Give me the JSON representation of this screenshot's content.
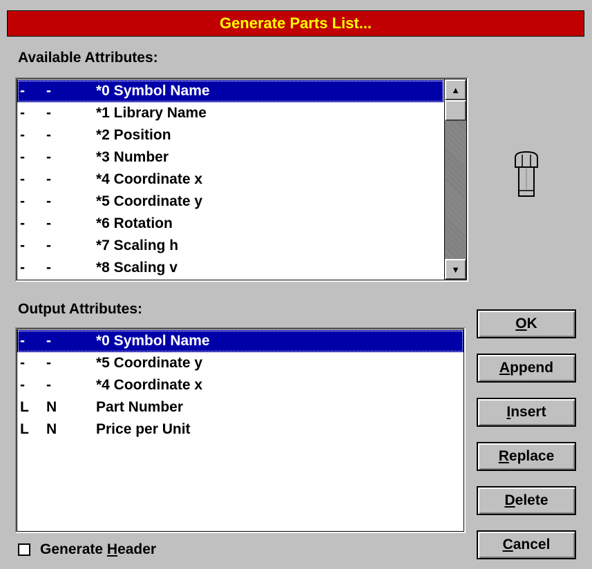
{
  "window": {
    "title": "Generate Parts List..."
  },
  "available": {
    "label": "Available Attributes:",
    "rows": [
      {
        "a": "-",
        "b": "-",
        "name": "*0 Symbol Name",
        "selected": true
      },
      {
        "a": "-",
        "b": "-",
        "name": "*1 Library Name",
        "selected": false
      },
      {
        "a": "-",
        "b": "-",
        "name": "*2 Position",
        "selected": false
      },
      {
        "a": "-",
        "b": "-",
        "name": "*3 Number",
        "selected": false
      },
      {
        "a": "-",
        "b": "-",
        "name": "*4 Coordinate x",
        "selected": false
      },
      {
        "a": "-",
        "b": "-",
        "name": "*5 Coordinate y",
        "selected": false
      },
      {
        "a": "-",
        "b": "-",
        "name": "*6 Rotation",
        "selected": false
      },
      {
        "a": "-",
        "b": "-",
        "name": "*7 Scaling h",
        "selected": false
      },
      {
        "a": "-",
        "b": "-",
        "name": "*8 Scaling v",
        "selected": false
      }
    ],
    "scroll_up_icon": "arrow-up-icon",
    "scroll_down_icon": "arrow-down-icon"
  },
  "output": {
    "label": "Output Attributes:",
    "rows": [
      {
        "a": "-",
        "b": "-",
        "name": "*0 Symbol Name",
        "selected": true
      },
      {
        "a": "-",
        "b": "-",
        "name": "*5 Coordinate y",
        "selected": false
      },
      {
        "a": "-",
        "b": "-",
        "name": "*4 Coordinate x",
        "selected": false
      },
      {
        "a": "L",
        "b": "N",
        "name": "Part Number",
        "selected": false
      },
      {
        "a": "L",
        "b": "N",
        "name": "Price per Unit",
        "selected": false
      }
    ]
  },
  "buttons": {
    "ok": {
      "mnemonic": "O",
      "rest": "K"
    },
    "append": {
      "mnemonic": "A",
      "rest": "ppend"
    },
    "insert": {
      "mnemonic": "I",
      "rest": "nsert"
    },
    "replace": {
      "mnemonic": "R",
      "rest": "eplace"
    },
    "delete": {
      "mnemonic": "D",
      "rest": "elete"
    },
    "cancel": {
      "mnemonic": "C",
      "rest": "ancel"
    }
  },
  "generate_header": {
    "label_before": "Generate ",
    "mnemonic": "H",
    "label_after": "eader",
    "checked": false
  },
  "icons": {
    "part_icon": "bolt-icon"
  },
  "colors": {
    "title_bg": "#c00000",
    "title_fg": "#ffff00",
    "selection_bg": "#0000a8",
    "dialog_bg": "#c0c0c0"
  }
}
